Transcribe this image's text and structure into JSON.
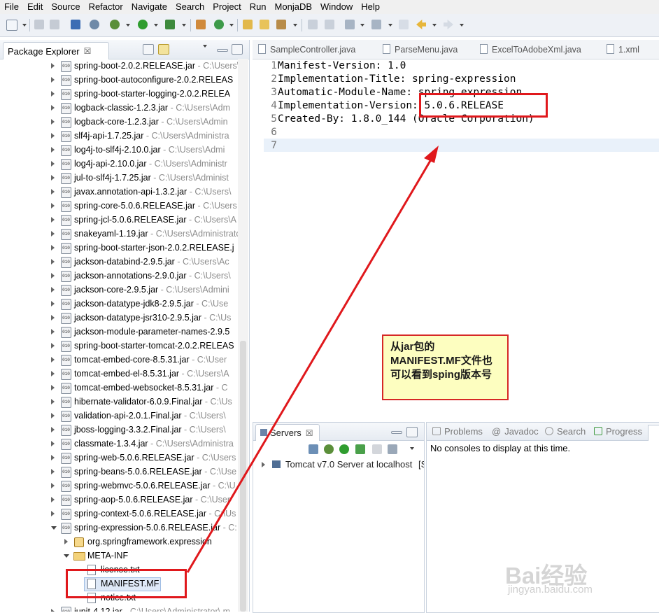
{
  "menu": [
    "File",
    "Edit",
    "Source",
    "Refactor",
    "Navigate",
    "Search",
    "Project",
    "Run",
    "MonjaDB",
    "Window",
    "Help"
  ],
  "explorer": {
    "title": "Package Explorer",
    "close": "☒",
    "rows": [
      {
        "name": "spring-boot-2.0.2.RELEASE.jar",
        "path": " - C:\\Users\\"
      },
      {
        "name": "spring-boot-autoconfigure-2.0.2.RELEAS",
        "path": ""
      },
      {
        "name": "spring-boot-starter-logging-2.0.2.RELEA",
        "path": ""
      },
      {
        "name": "logback-classic-1.2.3.jar",
        "path": " - C:\\Users\\Adm"
      },
      {
        "name": "logback-core-1.2.3.jar",
        "path": " - C:\\Users\\Admin"
      },
      {
        "name": "slf4j-api-1.7.25.jar",
        "path": " - C:\\Users\\Administra"
      },
      {
        "name": "log4j-to-slf4j-2.10.0.jar",
        "path": " - C:\\Users\\Admi"
      },
      {
        "name": "log4j-api-2.10.0.jar",
        "path": " - C:\\Users\\Administr"
      },
      {
        "name": "jul-to-slf4j-1.7.25.jar",
        "path": " - C:\\Users\\Administ"
      },
      {
        "name": "javax.annotation-api-1.3.2.jar",
        "path": " - C:\\Users\\"
      },
      {
        "name": "spring-core-5.0.6.RELEASE.jar",
        "path": " - C:\\Users"
      },
      {
        "name": "spring-jcl-5.0.6.RELEASE.jar",
        "path": " - C:\\Users\\A"
      },
      {
        "name": "snakeyaml-1.19.jar",
        "path": " - C:\\Users\\Administrato"
      },
      {
        "name": "spring-boot-starter-json-2.0.2.RELEASE.j",
        "path": ""
      },
      {
        "name": "jackson-databind-2.9.5.jar",
        "path": " - C:\\Users\\Ac"
      },
      {
        "name": "jackson-annotations-2.9.0.jar",
        "path": " - C:\\Users\\"
      },
      {
        "name": "jackson-core-2.9.5.jar",
        "path": " - C:\\Users\\Admini"
      },
      {
        "name": "jackson-datatype-jdk8-2.9.5.jar",
        "path": " - C:\\Use"
      },
      {
        "name": "jackson-datatype-jsr310-2.9.5.jar",
        "path": " - C:\\Us"
      },
      {
        "name": "jackson-module-parameter-names-2.9.5",
        "path": ""
      },
      {
        "name": "spring-boot-starter-tomcat-2.0.2.RELEAS",
        "path": ""
      },
      {
        "name": "tomcat-embed-core-8.5.31.jar",
        "path": " - C:\\User"
      },
      {
        "name": "tomcat-embed-el-8.5.31.jar",
        "path": " - C:\\Users\\A"
      },
      {
        "name": "tomcat-embed-websocket-8.5.31.jar",
        "path": " - C"
      },
      {
        "name": "hibernate-validator-6.0.9.Final.jar",
        "path": " - C:\\Us"
      },
      {
        "name": "validation-api-2.0.1.Final.jar",
        "path": " - C:\\Users\\"
      },
      {
        "name": "jboss-logging-3.3.2.Final.jar",
        "path": " - C:\\Users\\"
      },
      {
        "name": "classmate-1.3.4.jar",
        "path": " - C:\\Users\\Administra"
      },
      {
        "name": "spring-web-5.0.6.RELEASE.jar",
        "path": " - C:\\Users"
      },
      {
        "name": "spring-beans-5.0.6.RELEASE.jar",
        "path": " - C:\\Use"
      },
      {
        "name": "spring-webmvc-5.0.6.RELEASE.jar",
        "path": " - C:\\U"
      },
      {
        "name": "spring-aop-5.0.6.RELEASE.jar",
        "path": " - C:\\User"
      },
      {
        "name": "spring-context-5.0.6.RELEASE.jar",
        "path": " - C:\\Us"
      },
      {
        "name": "spring-expression-5.0.6.RELEASE.jar",
        "path": " - C:"
      }
    ],
    "package": "org.springframework.expression",
    "meta_inf": "META-INF",
    "files": [
      "license.txt",
      "MANIFEST.MF",
      "notice.txt"
    ],
    "last_row": {
      "name": "junit-4.12.jar",
      "path": " - C:\\Users\\Administrator\\.m"
    }
  },
  "editor": {
    "tabs": [
      "SampleController.java",
      "ParseMenu.java",
      "ExcelToAdobeXml.java",
      "1.xml"
    ],
    "lines": [
      {
        "n": "1",
        "t": "Manifest-Version: 1.0"
      },
      {
        "n": "2",
        "t": "Implementation-Title: spring-expression"
      },
      {
        "n": "3",
        "t": "Automatic-Module-Name: spring.expression"
      },
      {
        "n": "4",
        "t": "Implementation-Version: 5.0.6.RELEASE"
      },
      {
        "n": "5",
        "t": "Created-By: 1.8.0_144 (Oracle Corporation)"
      },
      {
        "n": "6",
        "t": ""
      },
      {
        "n": "7",
        "t": ""
      }
    ]
  },
  "servers": {
    "title": "Servers",
    "close": "☒",
    "item": "Tomcat v7.0 Server at localhost",
    "item_suffix": "[S"
  },
  "console": {
    "tabs": [
      "Problems",
      "Javadoc",
      "Search",
      "Progress"
    ],
    "message": "No consoles to display at this time."
  },
  "annotation": {
    "text": "从jar包的MANIFEST.MF文件也可以看到sping版本号",
    "color": "#e0181c"
  },
  "watermark": {
    "brand": "Bai经验",
    "url": "jingyan.baidu.com"
  }
}
